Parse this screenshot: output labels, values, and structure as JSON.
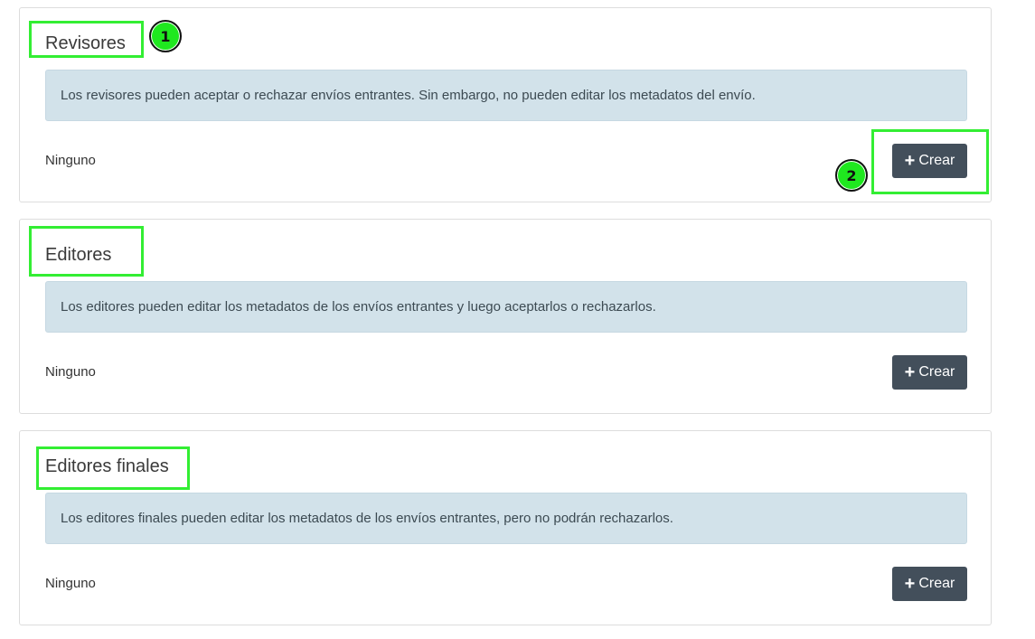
{
  "sections": [
    {
      "title": "Revisores",
      "description": "Los revisores pueden aceptar o rechazar envíos entrantes. Sin embargo, no pueden editar los metadatos del envío.",
      "empty_text": "Ninguno",
      "create_label": "Crear"
    },
    {
      "title": "Editores",
      "description": "Los editores pueden editar los metadatos de los envíos entrantes y luego aceptarlos o rechazarlos.",
      "empty_text": "Ninguno",
      "create_label": "Crear"
    },
    {
      "title": "Editores finales",
      "description": "Los editores finales pueden editar los metadatos de los envíos entrantes, pero no podrán rechazarlos.",
      "empty_text": "Ninguno",
      "create_label": "Crear"
    }
  ],
  "annotations": {
    "marker_1": "1",
    "marker_2": "2",
    "highlight_color": "#33ee33",
    "marker_color": "#1fe81f"
  },
  "colors": {
    "info_background": "#d2e2ea",
    "button_background": "#434f5b"
  },
  "icons": {
    "create": "plus-icon"
  }
}
